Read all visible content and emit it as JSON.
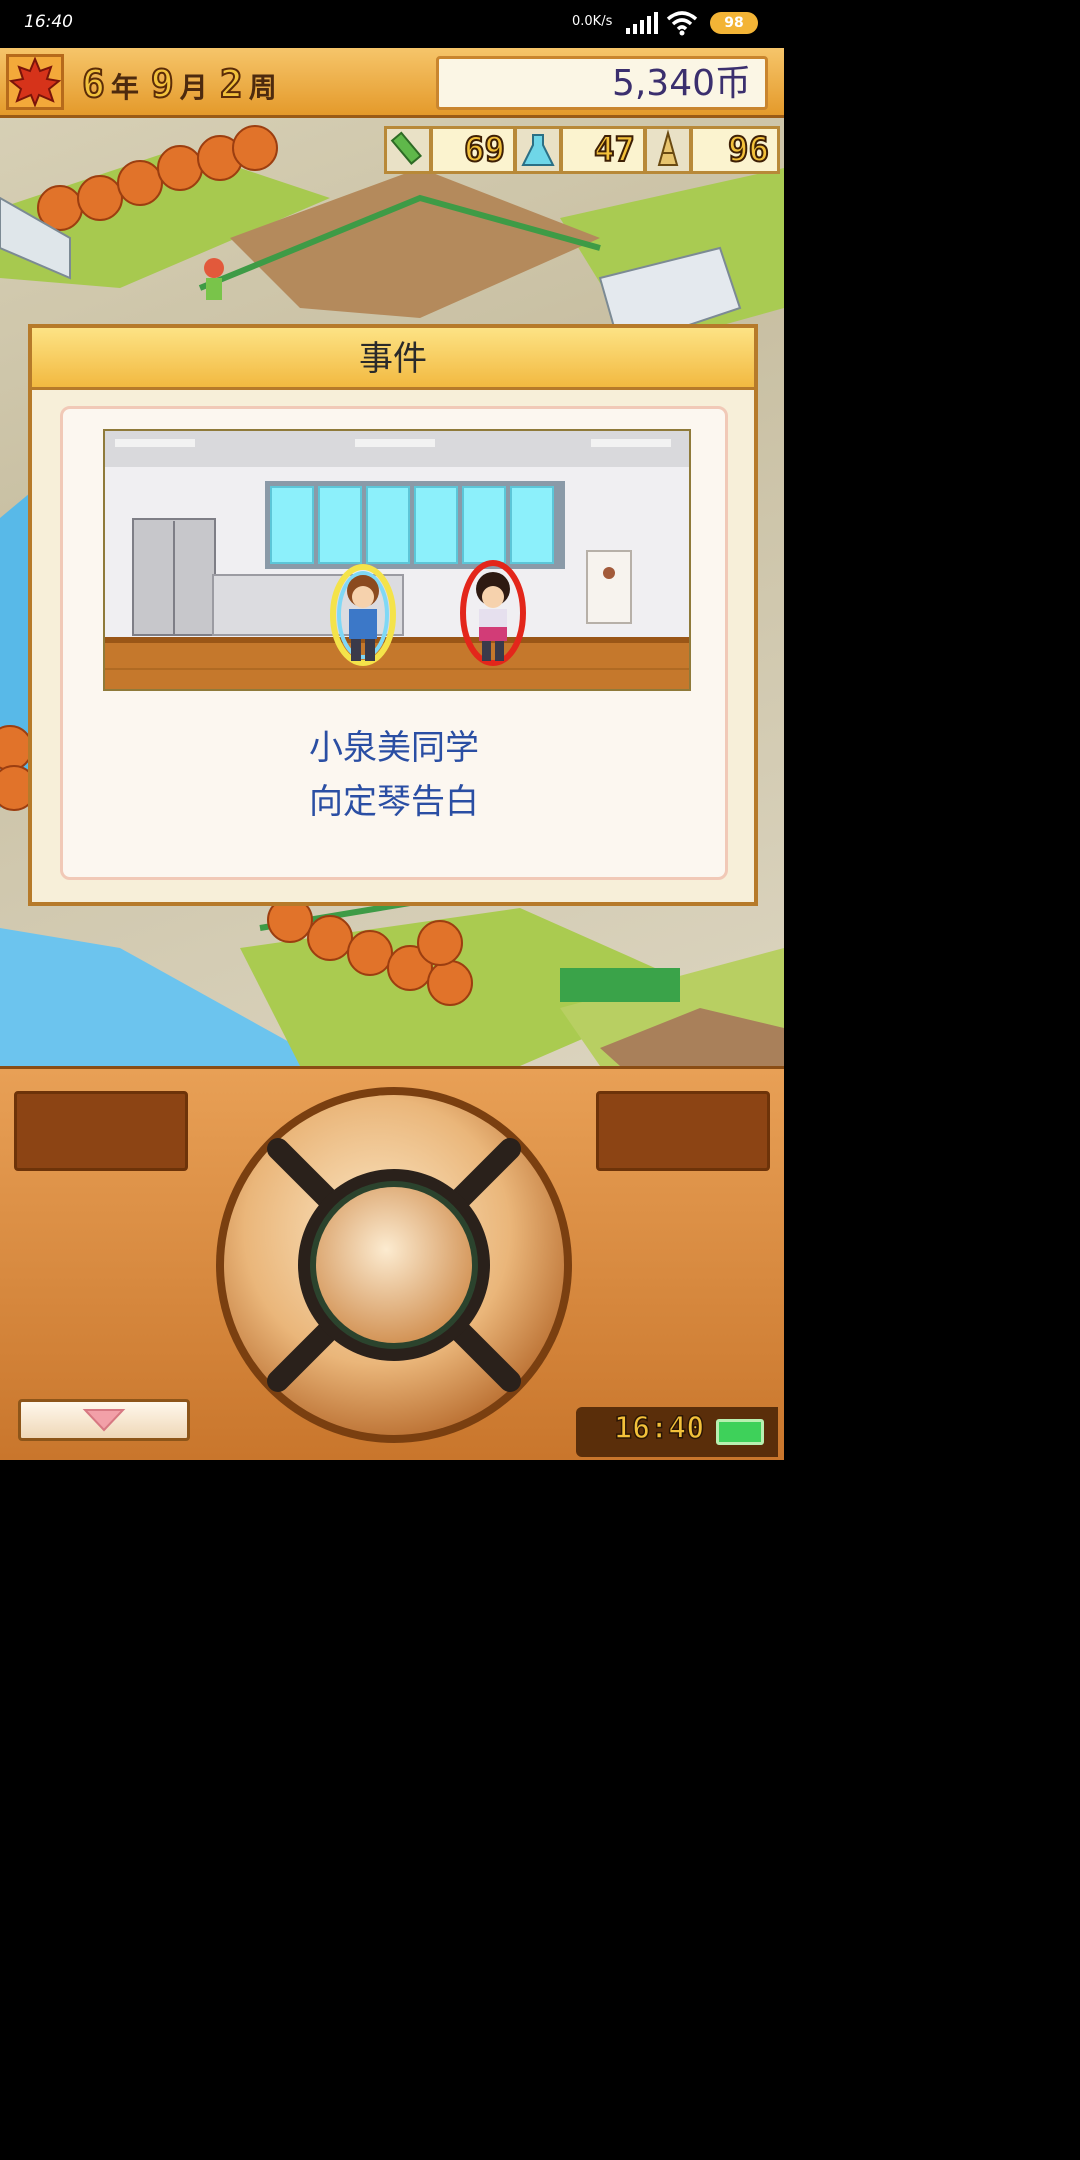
{
  "status_bar": {
    "time": "16:40",
    "speed": "0.0K/s",
    "battery": "98"
  },
  "topbar": {
    "year": "6",
    "year_unit": "年",
    "month": "9",
    "month_unit": "月",
    "week": "2",
    "week_unit": "周",
    "money": "5,340币"
  },
  "stats": [
    {
      "icon": "pencil-icon",
      "value": "69"
    },
    {
      "icon": "flask-icon",
      "value": "47"
    },
    {
      "icon": "tower-icon",
      "value": "96"
    }
  ],
  "event": {
    "title": "事件",
    "message_line1": "小泉美同学",
    "message_line2": "向定琴告白"
  },
  "controller": {
    "clock": "16:40"
  },
  "colors": {
    "dialog_title_bg": "#f2b940",
    "message_text": "#2a4ea3",
    "controller_bg": "#d98b3f"
  }
}
